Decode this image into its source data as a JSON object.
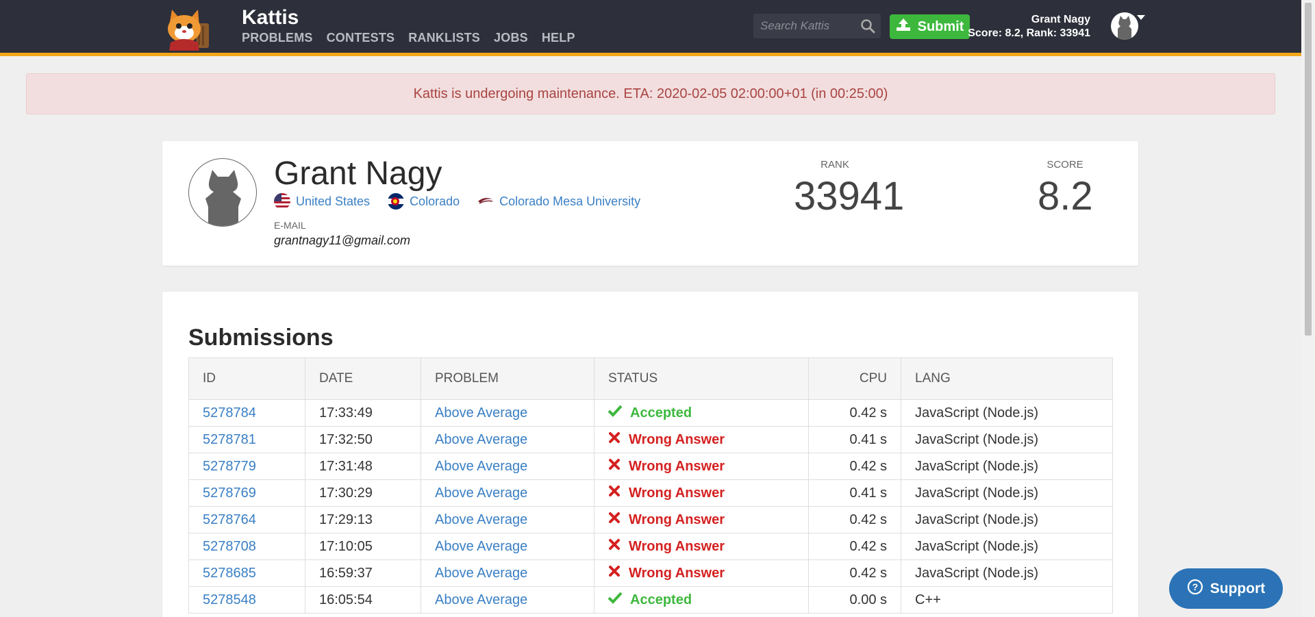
{
  "header": {
    "brand": "Kattis",
    "nav": [
      "PROBLEMS",
      "CONTESTS",
      "RANKLISTS",
      "JOBS",
      "HELP"
    ],
    "search_placeholder": "Search Kattis",
    "submit_label": "Submit",
    "user_name": "Grant Nagy",
    "user_stats": "Score: 8.2, Rank: 33941"
  },
  "alert": "Kattis is undergoing maintenance. ETA: 2020-02-05 02:00:00+01 (in 00:25:00)",
  "profile": {
    "name": "Grant Nagy",
    "country": "United States",
    "region": "Colorado",
    "university": "Colorado Mesa University",
    "email_label": "E-MAIL",
    "email": "grantnagy11@gmail.com",
    "rank_label": "RANK",
    "rank": "33941",
    "score_label": "SCORE",
    "score": "8.2"
  },
  "submissions": {
    "title": "Submissions",
    "columns": [
      "ID",
      "DATE",
      "PROBLEM",
      "STATUS",
      "CPU",
      "LANG"
    ],
    "rows": [
      {
        "id": "5278784",
        "date": "17:33:49",
        "problem": "Above Average",
        "status": "Accepted",
        "cpu": "0.42 s",
        "lang": "JavaScript (Node.js)"
      },
      {
        "id": "5278781",
        "date": "17:32:50",
        "problem": "Above Average",
        "status": "Wrong Answer",
        "cpu": "0.41 s",
        "lang": "JavaScript (Node.js)"
      },
      {
        "id": "5278779",
        "date": "17:31:48",
        "problem": "Above Average",
        "status": "Wrong Answer",
        "cpu": "0.42 s",
        "lang": "JavaScript (Node.js)"
      },
      {
        "id": "5278769",
        "date": "17:30:29",
        "problem": "Above Average",
        "status": "Wrong Answer",
        "cpu": "0.41 s",
        "lang": "JavaScript (Node.js)"
      },
      {
        "id": "5278764",
        "date": "17:29:13",
        "problem": "Above Average",
        "status": "Wrong Answer",
        "cpu": "0.42 s",
        "lang": "JavaScript (Node.js)"
      },
      {
        "id": "5278708",
        "date": "17:10:05",
        "problem": "Above Average",
        "status": "Wrong Answer",
        "cpu": "0.42 s",
        "lang": "JavaScript (Node.js)"
      },
      {
        "id": "5278685",
        "date": "16:59:37",
        "problem": "Above Average",
        "status": "Wrong Answer",
        "cpu": "0.42 s",
        "lang": "JavaScript (Node.js)"
      },
      {
        "id": "5278548",
        "date": "16:05:54",
        "problem": "Above Average",
        "status": "Accepted",
        "cpu": "0.00 s",
        "lang": "C++"
      }
    ]
  },
  "support_label": "Support",
  "colors": {
    "accent": "#f2a71b",
    "accepted": "#3db83d",
    "wrong": "#d42020",
    "link": "#3a7fc4",
    "header_bg": "#2d2f3a"
  }
}
